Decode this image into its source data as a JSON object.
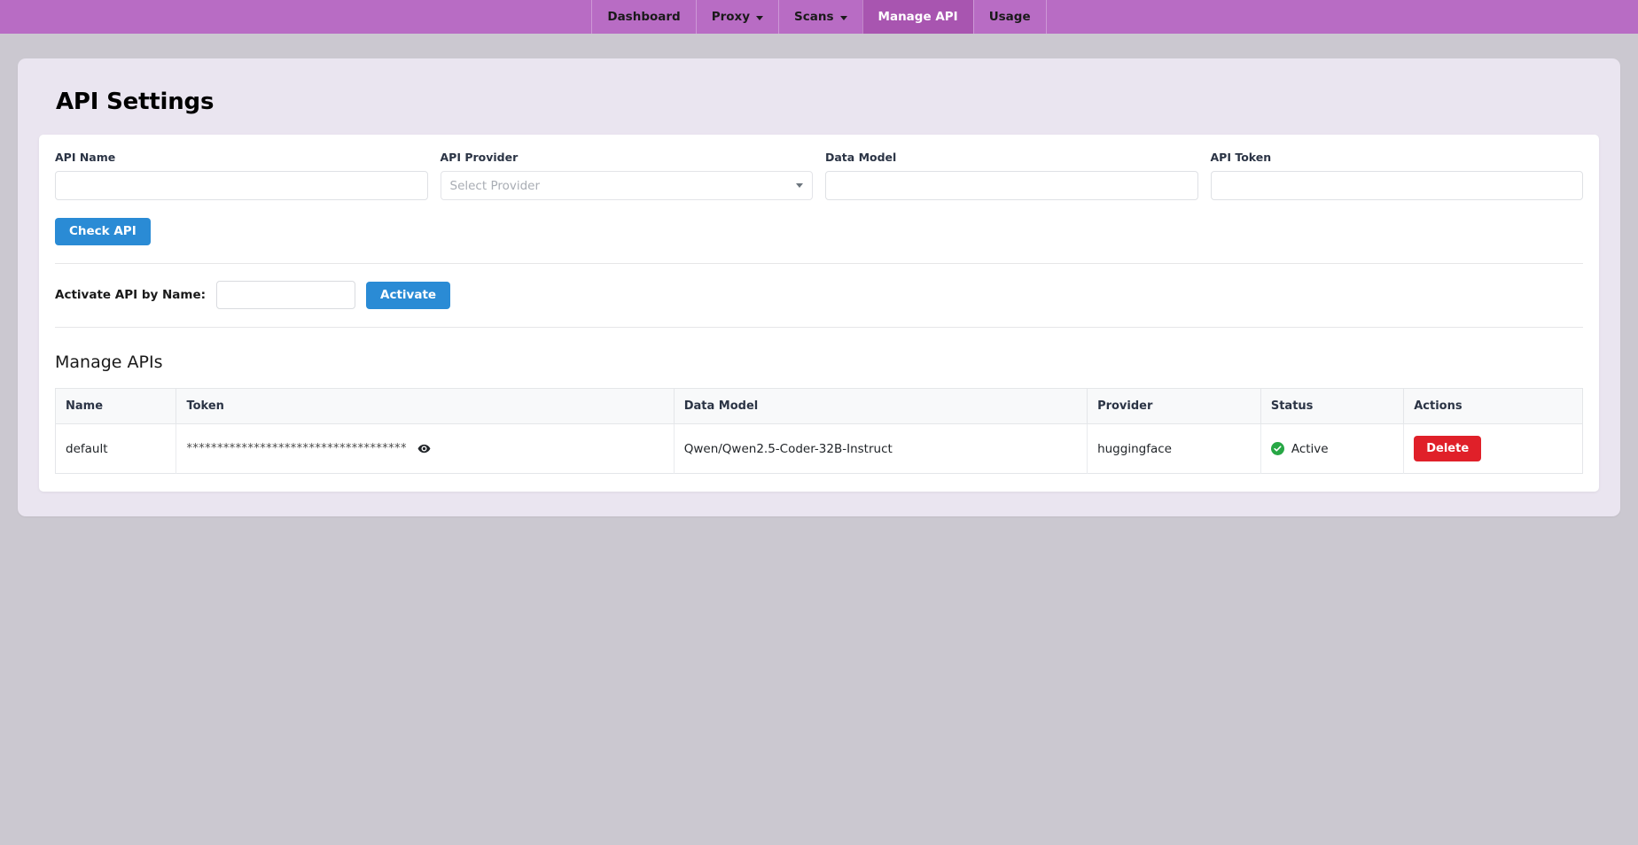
{
  "navbar": {
    "items": [
      {
        "label": "Dashboard",
        "has_caret": false,
        "active": false
      },
      {
        "label": "Proxy",
        "has_caret": true,
        "active": false
      },
      {
        "label": "Scans",
        "has_caret": true,
        "active": false
      },
      {
        "label": "Manage API",
        "has_caret": false,
        "active": true
      },
      {
        "label": "Usage",
        "has_caret": false,
        "active": false
      }
    ],
    "active_bg": "#a855b0",
    "bg": "#b86cc4"
  },
  "page": {
    "title": "API Settings",
    "bg": "#cbc8d0",
    "panel_bg": "#eae5f0"
  },
  "form": {
    "fields": [
      {
        "label": "API Name",
        "type": "text",
        "value": "",
        "placeholder": ""
      },
      {
        "label": "API Provider",
        "type": "select",
        "value": "",
        "placeholder": "Select Provider"
      },
      {
        "label": "Data Model",
        "type": "text",
        "value": "",
        "placeholder": ""
      },
      {
        "label": "API Token",
        "type": "text",
        "value": "",
        "placeholder": ""
      }
    ],
    "check_api_label": "Check API"
  },
  "activate": {
    "label": "Activate API by Name:",
    "input_value": "",
    "input_placeholder": "",
    "button_label": "Activate"
  },
  "manage": {
    "section_title": "Manage APIs",
    "columns": [
      "Name",
      "Token",
      "Data Model",
      "Provider",
      "Status",
      "Actions"
    ],
    "rows": [
      {
        "name": "default",
        "token_masked": "************************************",
        "data_model": "Qwen/Qwen2.5-Coder-32B-Instruct",
        "provider": "huggingface",
        "status": "Active",
        "status_color": "#27a745",
        "action_label": "Delete",
        "action_color": "#e02029"
      }
    ]
  },
  "colors": {
    "primary_blue": "#2a8bd5",
    "danger_red": "#e02029",
    "success_green": "#27a745"
  }
}
